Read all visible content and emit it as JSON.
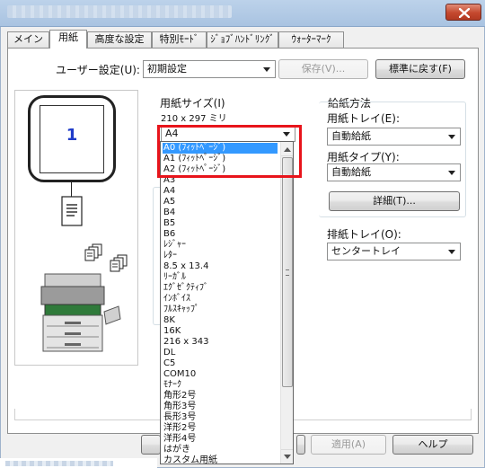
{
  "window": {
    "close_label": "×"
  },
  "tabs": [
    {
      "label": "メイン"
    },
    {
      "label": "用紙"
    },
    {
      "label": "高度な設定"
    },
    {
      "label": "特別ﾓｰﾄﾞ"
    },
    {
      "label": "ｼﾞｮﾌﾞﾊﾝﾄﾞﾘﾝｸﾞ"
    },
    {
      "label": "ｳｫｰﾀｰﾏｰｸ"
    }
  ],
  "user_settings": {
    "label": "ユーザー設定(U):",
    "value": "初期設定",
    "save_label": "保存(V)...",
    "reset_label": "標準に戻す(F)"
  },
  "preview": {
    "copy_number": "1"
  },
  "paper_size": {
    "label": "用紙サイズ(I)",
    "dimensions": "210 x 297 ミリ",
    "value": "A4"
  },
  "dropdown": {
    "items": [
      "A0 (ﾌｨｯﾄﾍﾟｰｼﾞ)",
      "A1 (ﾌｨｯﾄﾍﾟｰｼﾞ)",
      "A2 (ﾌｨｯﾄﾍﾟｰｼﾞ)",
      "A3",
      "A4",
      "A5",
      "B4",
      "B5",
      "B6",
      "ﾚｼﾞｬｰ",
      "ﾚﾀｰ",
      "8.5 x 13.4",
      "ﾘｰｶﾞﾙ",
      "ｴｸﾞｾﾞｸﾃｨﾌﾞ",
      "ｲﾝﾎﾞｲｽ",
      "ﾌﾙｽｷｬｯﾌﾟ",
      "8K",
      "16K",
      "216 x 343",
      "DL",
      "C5",
      "COM10",
      "ﾓﾅｰｸ",
      "角形2号",
      "角形3号",
      "長形3号",
      "洋形2号",
      "洋形4号",
      "はがき",
      "カスタム用紙"
    ],
    "selected_index": 0
  },
  "feed": {
    "group_label": "給紙方法",
    "tray_label": "用紙トレイ(E):",
    "tray_value": "自動給紙",
    "type_label": "用紙タイプ(Y):",
    "type_value": "自動給紙",
    "detail_label": "詳細(T)..."
  },
  "output": {
    "label": "排紙トレイ(O):",
    "value": "センタートレイ"
  },
  "footer": {
    "apply_label": "適用(A)",
    "help_label": "ヘルプ"
  },
  "colors": {
    "highlight": "#3399ff",
    "callout": "#e8141b",
    "accent_blue": "#1f3cc9"
  }
}
